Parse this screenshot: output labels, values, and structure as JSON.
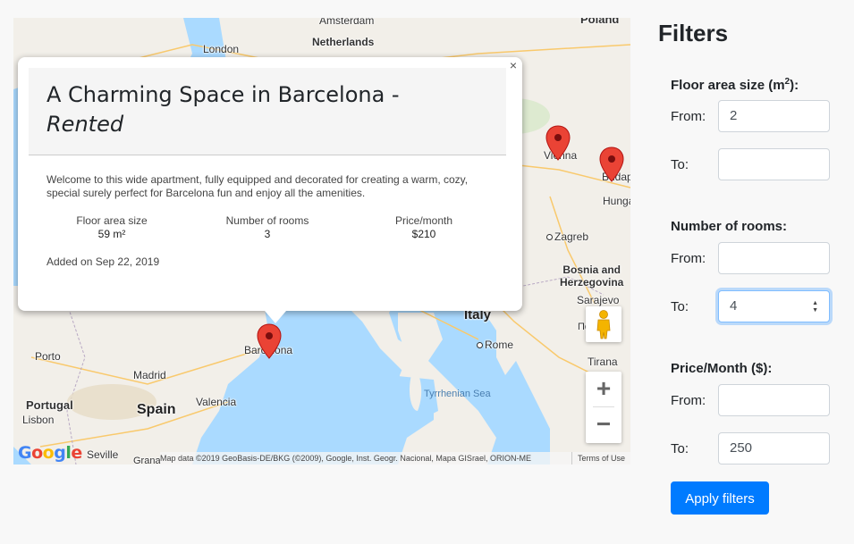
{
  "map": {
    "labels": {
      "amsterdam": "Amsterdam",
      "netherlands": "Netherlands",
      "london": "London",
      "vienna": "Vienna",
      "budapest": "Budapest",
      "hungary": "Hunga",
      "zagreb": "Zagreb",
      "bosnia": "Bosnia and\nHerzegovina",
      "sarajevo": "Sarajevo",
      "italy": "Italy",
      "rome": "Rome",
      "tyrrhenian": "Tyrrhenian Sea",
      "tirana": "Tirana",
      "podgorica": "Подг",
      "madrid": "Madrid",
      "spain": "Spain",
      "valencia": "Valencia",
      "portugal": "Portugal",
      "lisbon": "Lisbon",
      "porto": "Porto",
      "seville": "Seville",
      "barcelona": "Barcelona",
      "granada": "Grana",
      "poland": "Poland"
    },
    "google_logo": "Google",
    "attribution": "Map data ©2019 GeoBasis-DE/BKG (©2009), Google, Inst. Geogr. Nacional, Mapa GISrael, ORION-ME",
    "terms": "Terms of Use",
    "zoom_in": "+",
    "zoom_out": "−",
    "close": "×",
    "popup": {
      "title": "A Charming Space in Barcelona -",
      "title_status": "Rented",
      "description": "Welcome to this wide apartment, fully equipped and decorated for creating a warm, cozy, special surely perfect for Barcelona fun and enjoy all the amenities.",
      "stats": [
        {
          "label": "Floor area size",
          "value": "59 m²"
        },
        {
          "label": "Number of rooms",
          "value": "3"
        },
        {
          "label": "Price/month",
          "value": "$210"
        }
      ],
      "added": "Added on Sep 22, 2019"
    }
  },
  "filters": {
    "title": "Filters",
    "area": {
      "heading": "Floor area size (m²):",
      "from_label": "From:",
      "from_value": "2",
      "to_label": "To:",
      "to_value": ""
    },
    "rooms": {
      "heading": "Number of rooms:",
      "from_label": "From:",
      "from_value": "",
      "to_label": "To:",
      "to_value": "4"
    },
    "price": {
      "heading": "Price/Month ($):",
      "from_label": "From:",
      "from_value": "",
      "to_label": "To:",
      "to_value": "250"
    },
    "apply": "Apply filters"
  },
  "colors": {
    "accent": "#007bff",
    "pin": "#ea4335",
    "water": "#aadaff",
    "land": "#f2efe9"
  }
}
